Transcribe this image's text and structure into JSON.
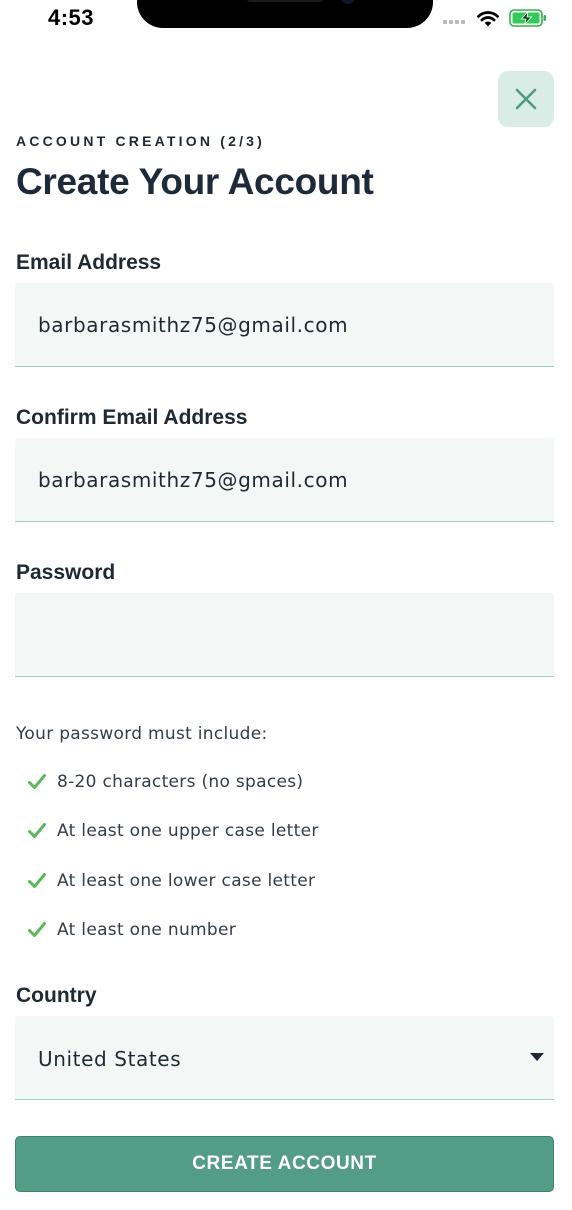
{
  "status_bar": {
    "time": "4:53",
    "icons": [
      "cellular-signal-icon",
      "wifi-icon",
      "battery-charging-icon"
    ]
  },
  "header": {
    "close_icon": "close-icon",
    "step_label": "ACCOUNT CREATION (2/3)",
    "title": "Create Your Account"
  },
  "form": {
    "email": {
      "label": "Email Address",
      "value": "barbarasmithz75@gmail.com"
    },
    "confirm_email": {
      "label": "Confirm Email Address",
      "value": "barbarasmithz75@gmail.com"
    },
    "password": {
      "label": "Password",
      "value": ""
    },
    "password_rules": {
      "intro": "Your password must include:",
      "items": [
        {
          "text": "8-20 characters (no spaces)",
          "met": true
        },
        {
          "text": "At least one upper case letter",
          "met": true
        },
        {
          "text": "At least one lower case letter",
          "met": true
        },
        {
          "text": "At least one number",
          "met": true
        }
      ]
    },
    "country": {
      "label": "Country",
      "value": "United States"
    },
    "submit_label": "CREATE ACCOUNT"
  },
  "colors": {
    "accent": "#539c85",
    "check": "#5cb85c",
    "close_bg": "#d9ece6",
    "field_bg": "#f3f8f6",
    "field_underline": "#9fd0bd",
    "text": "#1f2933"
  }
}
